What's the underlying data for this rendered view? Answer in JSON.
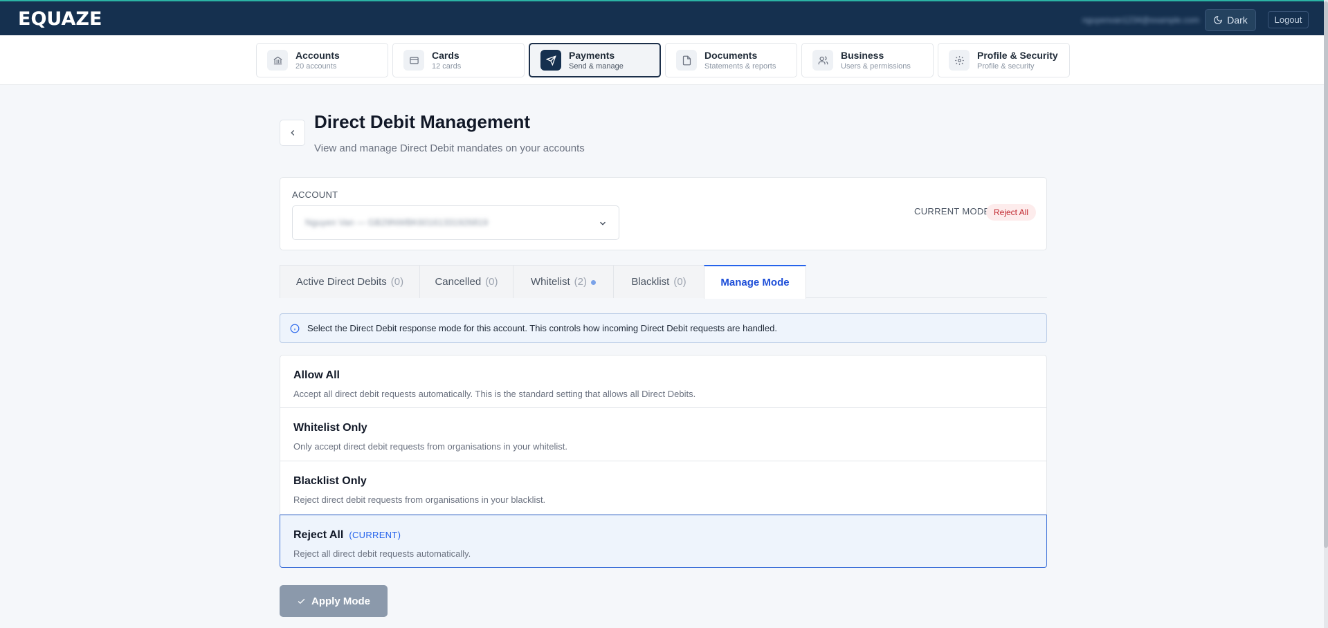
{
  "header": {
    "logo": "EQUAZE",
    "email": "nguyenvan1234@example.com",
    "theme_label": "Dark",
    "logout_label": "Logout"
  },
  "nav": {
    "items": [
      {
        "title": "Accounts",
        "sub": "20 accounts",
        "icon": "bank-icon"
      },
      {
        "title": "Cards",
        "sub": "12 cards",
        "icon": "credit-card-icon"
      },
      {
        "title": "Payments",
        "sub": "Send & manage",
        "icon": "send-icon"
      },
      {
        "title": "Documents",
        "sub": "Statements & reports",
        "icon": "document-icon"
      },
      {
        "title": "Business",
        "sub": "Users & permissions",
        "icon": "users-icon"
      },
      {
        "title": "Profile & Security",
        "sub": "Profile & security",
        "icon": "gear-icon"
      }
    ],
    "active_index": 2
  },
  "page": {
    "title": "Direct Debit Management",
    "subtitle": "View and manage Direct Debit mandates on your accounts"
  },
  "account": {
    "label": "ACCOUNT",
    "value": "Nguyen Van — GB29NWBK60161331926819",
    "current_mode_label": "CURRENT MODE",
    "current_mode": "Reject All"
  },
  "tabs": [
    {
      "label": "Active Direct Debits",
      "count": "(0)"
    },
    {
      "label": "Cancelled",
      "count": "(0)"
    },
    {
      "label": "Whitelist",
      "count": "(2)"
    },
    {
      "label": "Blacklist",
      "count": "(0)"
    },
    {
      "label": "Manage Mode",
      "count": ""
    }
  ],
  "info": "Select the Direct Debit response mode for this account. This controls how incoming Direct Debit requests are handled.",
  "modes": [
    {
      "title": "Allow All",
      "desc": "Accept all direct debit requests automatically. This is the standard setting that allows all Direct Debits."
    },
    {
      "title": "Whitelist Only",
      "desc": "Only accept direct debit requests from organisations in your whitelist."
    },
    {
      "title": "Blacklist Only",
      "desc": "Reject direct debit requests from organisations in your blacklist."
    },
    {
      "title": "Reject All",
      "desc": "Reject all direct debit requests automatically.",
      "current_tag": "(CURRENT)"
    }
  ],
  "apply_label": "Apply Mode",
  "colors": {
    "header_bg": "#15304f",
    "accent": "#2563eb",
    "reject_badge": "#c0262d"
  }
}
